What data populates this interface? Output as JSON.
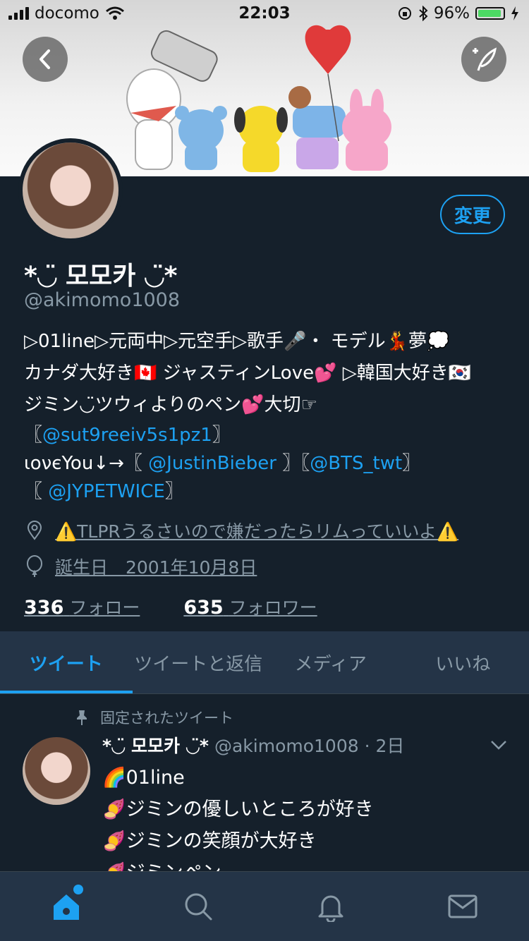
{
  "status": {
    "carrier": "docomo",
    "time": "22:03",
    "battery": "96%",
    "battery_level": 0.96
  },
  "header": {
    "back_icon": "chevron-left-icon",
    "compose_icon": "compose-feather-icon"
  },
  "profile": {
    "edit_label": "変更",
    "name": "*◡̈ 모모카 ◡̈*",
    "handle": "@akimomo1008",
    "bio": {
      "line1": "▷01line▷元両中▷元空手▷歌手🎤・ モデル💃夢💭",
      "line2": "カナダ大好き🇨🇦 ジャスティンLove💕 ▷韓国大好き🇰🇷",
      "line3": "ジミン◡̈ツウィよりのペン💕大切☞",
      "line4_open": "〖",
      "line4_link": "@sut9reeiv5s1pz1",
      "line4_close": "〗",
      "line5_text": "ιονєYou↓→〖",
      "line5_link1": "@JustinBieber",
      "line5_mid": "〗〖",
      "line5_link2": "@BTS_twt",
      "line5_close": "〗",
      "line6_open": "〖",
      "line6_link": "@JYPETWICE",
      "line6_close": "〗"
    },
    "location": "⚠️TLPRうるさいので嫌だったらリムっていいよ⚠️",
    "birthday": "誕生日　2001年10月8日",
    "following_count": "336",
    "following_label": "フォロー",
    "followers_count": "635",
    "followers_label": "フォロワー"
  },
  "tabs": [
    "ツイート",
    "ツイートと返信",
    "メディア",
    "いいね"
  ],
  "tweet": {
    "pinned_label": "固定されたツイート",
    "name": "*◡̈ 모모카 ◡̈*",
    "handle_time": "@akimomo1008 · 2日",
    "lines": [
      "🌈01line",
      "🍠ジミンの優しいところが好き",
      "🍠ジミンの笑顔が大好き",
      "🍠ジミンペン"
    ]
  },
  "nav_icons": [
    "home-icon",
    "search-icon",
    "notifications-bell-icon",
    "messages-envelope-icon"
  ],
  "colors": {
    "accent": "#1da1f2",
    "background": "#15202b",
    "secondary": "#8899a6"
  }
}
